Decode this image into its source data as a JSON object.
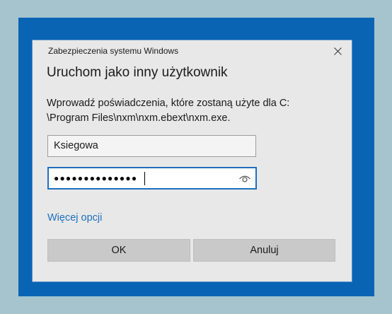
{
  "dialog": {
    "window_title": "Zabezpieczenia systemu Windows",
    "heading": "Uruchom jako inny użytkownik",
    "description_line1": "Wprowadź poświadczenia, które zostaną użyte dla C:",
    "description_line2": "\\Program Files\\nxm\\nxm.ebext\\nxm.exe.",
    "username_value": "Ksiegowa",
    "password_masked": "●●●●●●●●●●●●●●",
    "more_options_label": "Więcej opcji",
    "ok_label": "OK",
    "cancel_label": "Anuluj"
  },
  "icons": {
    "close": "close-icon",
    "reveal_password": "eye-icon"
  },
  "colors": {
    "desktop_background": "#a5c4cd",
    "frame_blue": "#0a64b4",
    "dialog_background": "#e8e8e8",
    "accent": "#1e6fbd",
    "button_gray": "#c9c9c9"
  }
}
